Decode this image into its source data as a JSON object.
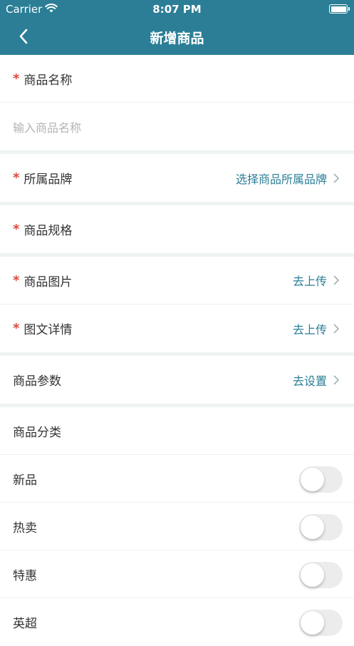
{
  "status": {
    "carrier": "Carrier",
    "time": "8:07 PM"
  },
  "nav": {
    "title": "新增商品"
  },
  "form": {
    "required_mark": "*",
    "name_label": "商品名称",
    "name_placeholder": "输入商品名称",
    "brand_label": "所属品牌",
    "brand_action": "选择商品所属品牌",
    "spec_label": "商品规格",
    "image_label": "商品图片",
    "image_action": "去上传",
    "detail_label": "图文详情",
    "detail_action": "去上传",
    "params_label": "商品参数",
    "params_action": "去设置",
    "category_label": "商品分类"
  },
  "toggles": [
    {
      "label": "新品",
      "on": false
    },
    {
      "label": "热卖",
      "on": false
    },
    {
      "label": "特惠",
      "on": false
    },
    {
      "label": "英超",
      "on": false
    }
  ],
  "colors": {
    "primary": "#2b7e96",
    "required": "#e0473a",
    "placeholder": "#b4b4b4"
  }
}
